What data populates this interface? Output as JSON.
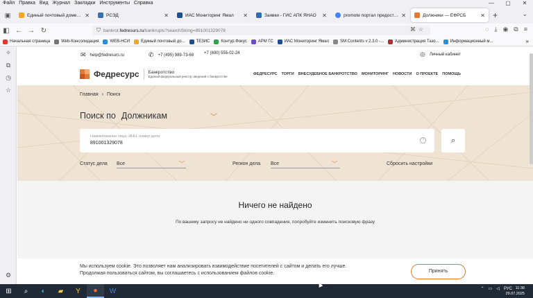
{
  "menubar": {
    "items": [
      "Файл",
      "Правка",
      "Вид",
      "Журнал",
      "Закладки",
      "Инструменты",
      "Справка"
    ]
  },
  "window_controls": [
    "—",
    "▢",
    "✕"
  ],
  "tabs": [
    {
      "label": "Единый почтовый домен ЯНАО",
      "color": "#f5a623"
    },
    {
      "label": "РСЭД",
      "color": "#3a6fb5"
    },
    {
      "label": "ИАС Мониторинг Ямал",
      "color": "#1d4f91"
    },
    {
      "label": "Заявки - ГИС АПК ЯНАО",
      "color": "#2f6db5"
    },
    {
      "label": "promote портал предоставле...",
      "color": "#4285f4"
    },
    {
      "label": "Должники — ЕФРСБ",
      "color": "#e07a35",
      "active": true
    }
  ],
  "url": {
    "prefix": "bankrot.",
    "domain": "fedresurs.ru",
    "path": "/bankrupts?searchString=891001329078"
  },
  "bookmarks": [
    {
      "label": "Начальная страница",
      "color": "#e0392b"
    },
    {
      "label": "Web-Консолидация",
      "color": "#777"
    },
    {
      "label": "WEB-НСИ",
      "color": "#2b8fd6"
    },
    {
      "label": "Единый почтовый до...",
      "color": "#f5a623"
    },
    {
      "label": "ТЕЗИС",
      "color": "#1d4f91"
    },
    {
      "label": "Контур.Фокус",
      "color": "#37a04f"
    },
    {
      "label": "АРМ ГС",
      "color": "#6b4fc6"
    },
    {
      "label": "ИАС Мониторинг Ямал",
      "color": "#1d4f91"
    },
    {
      "label": "SM:Contents v 2.3.0 -...",
      "color": "#888"
    },
    {
      "label": "Администрация Тазо...",
      "color": "#b03030"
    },
    {
      "label": "Информационный м...",
      "color": "#2b8fd6"
    }
  ],
  "site": {
    "email": "help@fedresurs.ru",
    "phone1": "+7 (495) 989-73-68",
    "phone2": "+7 (800) 555-02-24",
    "account": "Личный кабинет",
    "logo_name": "Федресурс",
    "logo_sub1": "Банкротство",
    "logo_sub2": "Единый федеральный реестр сведений о банкротстве",
    "nav": [
      "ФЕДРЕСУРС",
      "ТОРГИ",
      "ВНЕСУДЕБНОЕ БАНКРОТСТВО",
      "МОНИТОРИНГ",
      "НОВОСТИ",
      "О ПРОЕКТЕ",
      "ПОМОЩЬ"
    ],
    "breadcrumb": [
      "Главная",
      "Поиск"
    ],
    "search_label": "Поиск по",
    "search_target": "Должникам",
    "search_placeholder": "Наименование лица, ИНН, номер дела",
    "search_value": "891001329078",
    "filter1_label": "Статус дела",
    "filter1_value": "Все",
    "filter2_label": "Регион дела",
    "filter2_value": "Все",
    "reset": "Сбросить настройки",
    "empty_title": "Ничего не найдено",
    "empty_desc": "По вашему запросу не найдено ни одного совпадения, попробуйте изменить поисковую фразу",
    "cookie_line1": "Мы используем cookie. Это позволяет нам анализировать взаимодействие посетителей с сайтом и делать его лучше.",
    "cookie_line2": "Продолжая пользоваться сайтом, вы соглашаетесь с использованием файлов cookie.",
    "cookie_btn": "Принять"
  },
  "taskbar": {
    "lang": "РУС",
    "time": "11:38",
    "date": "29.07.2025"
  },
  "colors": {
    "accent": "#e07a35",
    "hero_bg": "#efe3d4"
  }
}
